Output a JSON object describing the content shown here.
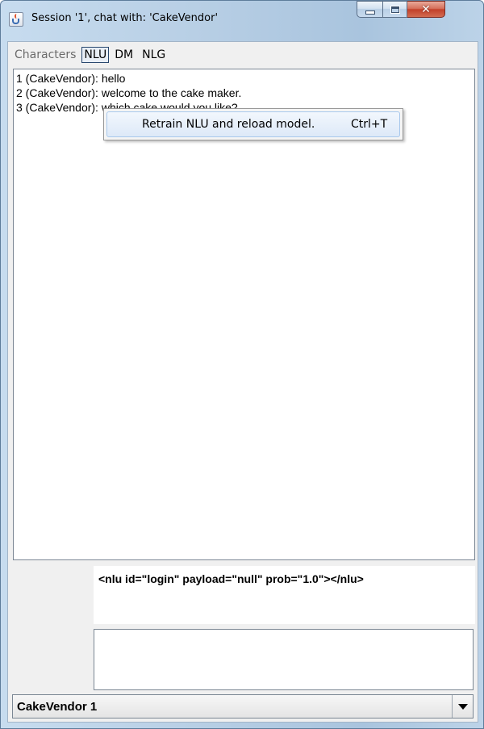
{
  "window": {
    "title": "Session '1', chat with: 'CakeVendor'",
    "accent_color": "#c2402a"
  },
  "menubar": {
    "items": [
      {
        "label": "Characters",
        "disabled": true
      },
      {
        "label": "NLU",
        "active": true
      },
      {
        "label": "DM"
      },
      {
        "label": "NLG"
      }
    ]
  },
  "nlu_menu": {
    "items": [
      {
        "label": "Retrain NLU and reload model.",
        "accelerator": "Ctrl+T"
      }
    ]
  },
  "chat": {
    "lines": [
      "1 (CakeVendor): hello",
      "2 (CakeVendor): welcome to the cake maker.",
      "3 (CakeVendor): which cake would you like?"
    ]
  },
  "nlu_output": {
    "text": "<nlu id=\"login\" payload=\"null\" prob=\"1.0\"></nlu>"
  },
  "input": {
    "value": ""
  },
  "character_select": {
    "selected": "CakeVendor 1"
  }
}
